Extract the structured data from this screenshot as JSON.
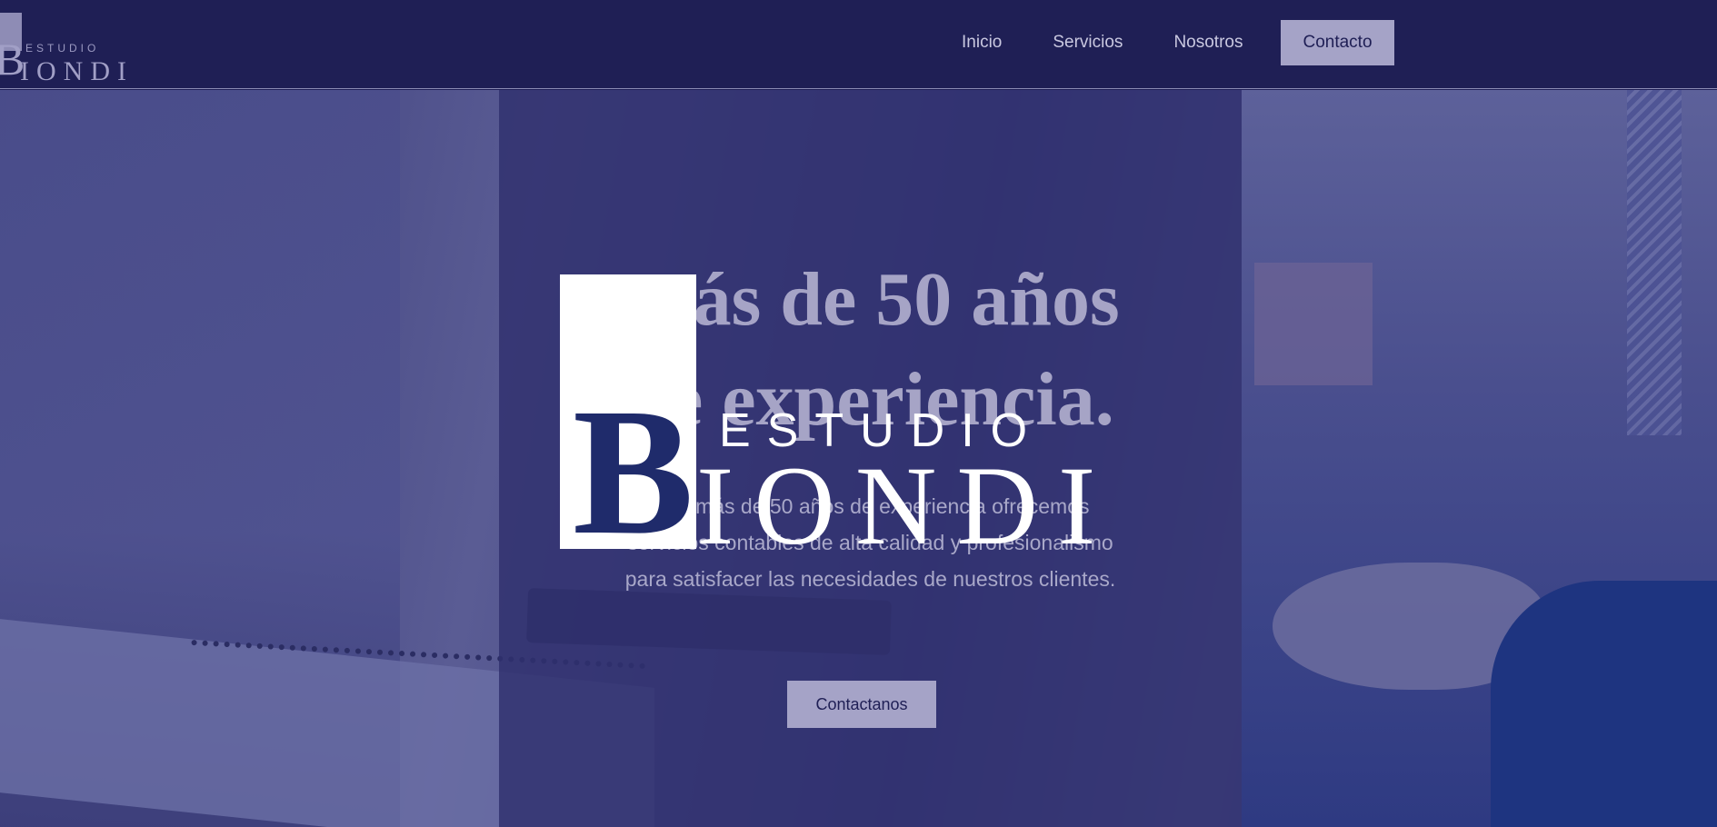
{
  "brand": {
    "estudio": "ESTUDIO",
    "initial": "B",
    "name_rest": "IONDI"
  },
  "nav": {
    "items": [
      {
        "label": "Inicio"
      },
      {
        "label": "Servicios"
      },
      {
        "label": "Nosotros"
      },
      {
        "label": "Contacto"
      }
    ],
    "active": "Contacto"
  },
  "hero": {
    "headline_line1": "Más de 50 años",
    "headline_line2": "de experiencia.",
    "body_line1": "Con más de 50 años de experiencia ofrecemos",
    "body_line2": "servicios contables de alta calidad y profesionalismo",
    "body_line3": "para satisfacer las necesidades de nuestros clientes.",
    "cta_label": "Contactanos"
  },
  "colors": {
    "header_bg": "#1f1f55",
    "overlay": "#30306e",
    "accent": "#a5a3c7",
    "logo_b": "#1f2b6b"
  }
}
